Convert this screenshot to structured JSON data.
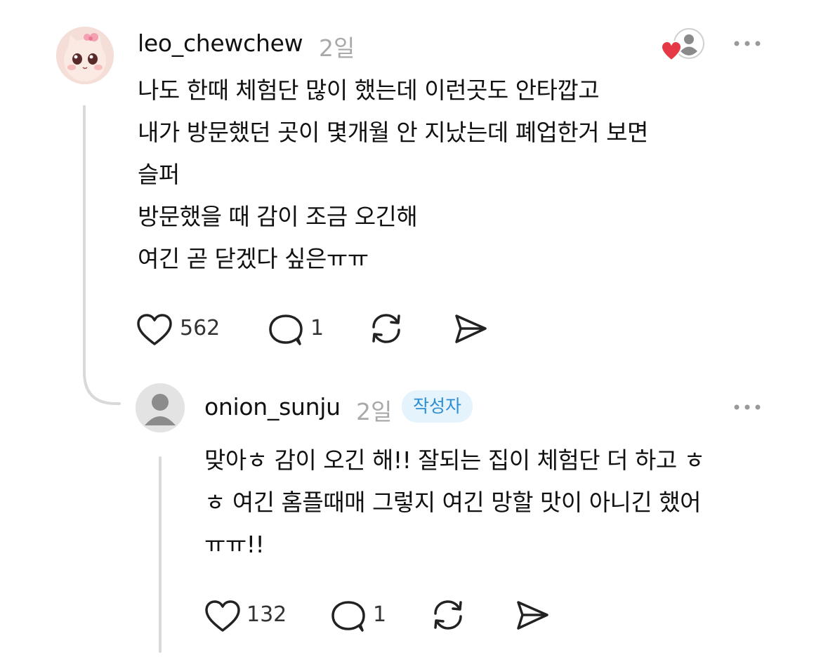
{
  "post": {
    "username": "leo_chewchew",
    "time": "2일",
    "lines": [
      "나도 한때 체험단 많이 했는데 이런곳도 안타깝고",
      "내가 방문했던 곳이 몇개월 안 지났는데 폐업한거 보면",
      "슬퍼",
      "방문했을 때 감이 조금 오긴해",
      "여긴 곧 닫겠다 싶은ㅠㅠ"
    ],
    "likes": "562",
    "replies": "1",
    "icons": {
      "avatar": "cartoon-cat-avatar",
      "liked_by": "liked-by-author-icon",
      "more": "more-options-icon",
      "like": "heart-icon",
      "reply": "reply-bubble-icon",
      "repost": "repost-icon",
      "share": "send-icon"
    }
  },
  "reply": {
    "username": "onion_sunju",
    "time": "2일",
    "badge": "작성자",
    "lines": [
      "맞아ㅎ 감이 오긴 해!! 잘되는 집이 체험단 더 하고 ㅎ",
      "ㅎ 여긴 홈플때매 그렇지 여긴 망할 맛이 아니긴 했어",
      "ㅠㅠ!!"
    ],
    "likes": "132",
    "replies": "1",
    "icons": {
      "avatar": "default-user-avatar",
      "more": "more-options-icon",
      "like": "heart-icon",
      "reply": "reply-bubble-icon",
      "repost": "repost-icon",
      "share": "send-icon"
    }
  },
  "colors": {
    "background": "#ffffff",
    "text": "#111111",
    "muted": "#a9a9a9",
    "badge_bg": "#e5f3fc",
    "badge_text": "#2e8ed4",
    "liked_heart": "#e53946"
  }
}
